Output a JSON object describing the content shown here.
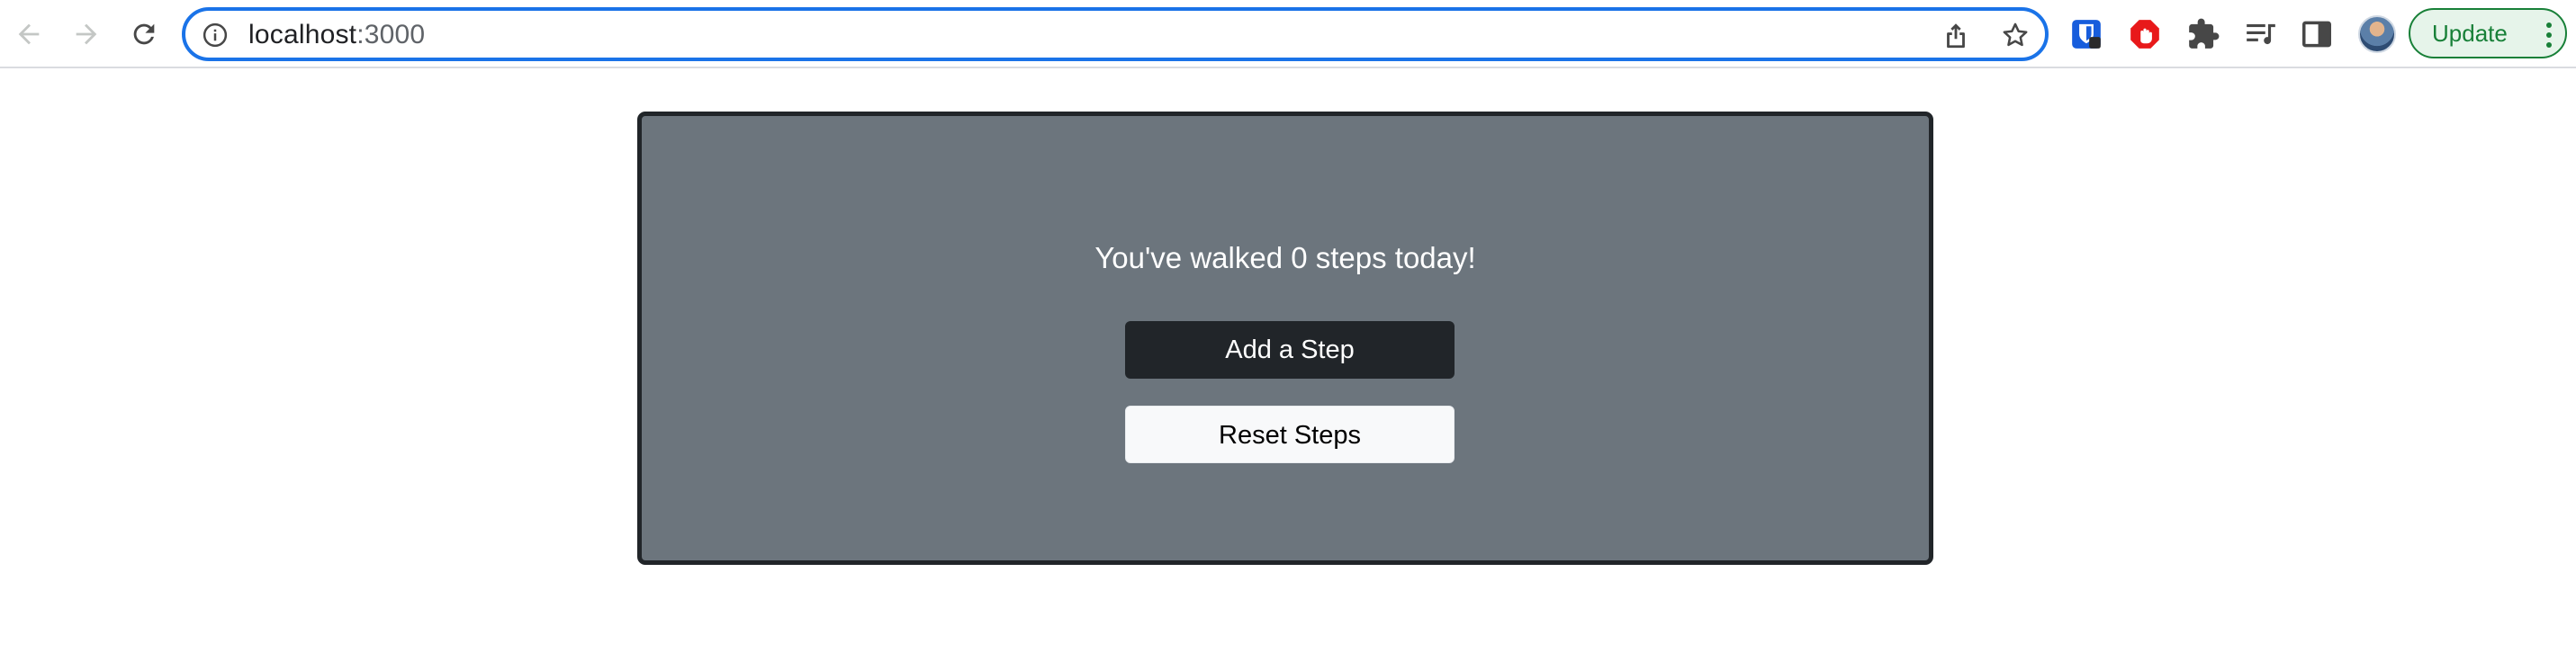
{
  "browser": {
    "url_host": "localhost",
    "url_port": ":3000",
    "update_label": "Update"
  },
  "page": {
    "steps_message": "You've walked 0 steps today!",
    "step_count": 0,
    "add_step_label": "Add a Step",
    "reset_steps_label": "Reset Steps"
  },
  "colors": {
    "card_background": "#6c757d",
    "card_border": "#212529",
    "add_button_background": "#212529",
    "reset_button_background": "#f8f9fa",
    "omnibox_focus": "#1a73e8",
    "update_green": "#188038"
  },
  "icons": {
    "back": "arrow-left",
    "forward": "arrow-right",
    "reload": "refresh",
    "site_info": "info-circle",
    "share": "share",
    "bookmark": "star-outline",
    "extensions": [
      "bitwarden-shield",
      "stop-hand",
      "puzzle",
      "media-queue",
      "side-panel"
    ]
  }
}
